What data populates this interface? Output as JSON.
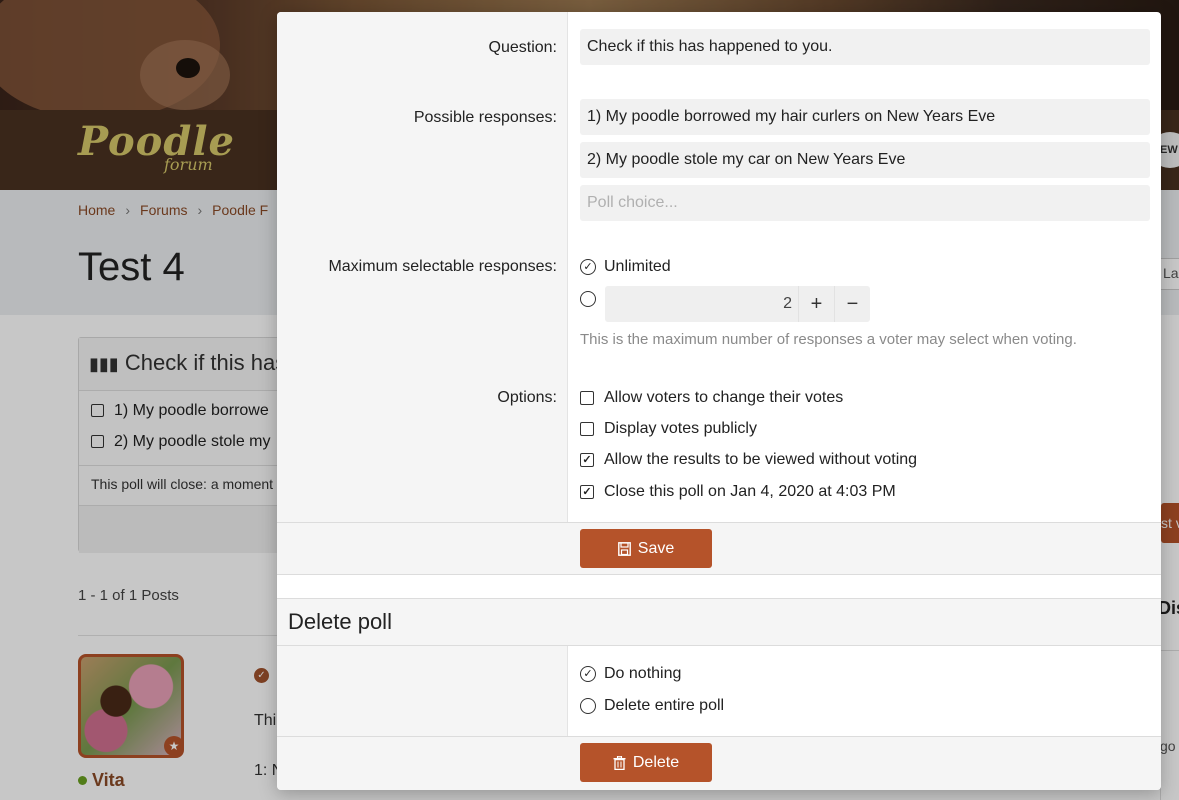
{
  "background": {
    "logo": {
      "main": "Poodle",
      "sub": "forum"
    },
    "new_badge": "EW",
    "breadcrumb": [
      "Home",
      "Forums",
      "Poodle F"
    ],
    "thread_title": "Test 4",
    "right_input_text": "La",
    "poll": {
      "title": "Check if this has",
      "responses": [
        "1) My poodle borrowe",
        "2) My poodle stole my"
      ],
      "close_text": "This poll will close: a moment"
    },
    "posts_count": "1 - 1 of 1 Posts",
    "username": "Vita",
    "post_fragment_1": "Thi",
    "post_fragment_2": "1: N",
    "right_button_text": "st v",
    "right_heading": "Dis",
    "right_ago": "go"
  },
  "modal": {
    "question": {
      "label": "Question:",
      "value": "Check if this has happened to you."
    },
    "responses": {
      "label": "Possible responses:",
      "items": [
        "1) My poodle borrowed my hair curlers on New Years Eve",
        "2) My poodle stole my car on New Years Eve"
      ],
      "placeholder": "Poll choice..."
    },
    "max_responses": {
      "label": "Maximum selectable responses:",
      "unlimited_label": "Unlimited",
      "unlimited_selected": true,
      "count_value": "2",
      "increment": "+",
      "decrement": "−",
      "hint": "This is the maximum number of responses a voter may select when voting."
    },
    "options": {
      "label": "Options:",
      "items": [
        {
          "label": "Allow voters to change their votes",
          "checked": false
        },
        {
          "label": "Display votes publicly",
          "checked": false
        },
        {
          "label": "Allow the results to be viewed without voting",
          "checked": true
        },
        {
          "label": "Close this poll on Jan 4, 2020 at 4:03 PM",
          "checked": true
        }
      ]
    },
    "save_label": "Save",
    "delete_section": {
      "title": "Delete poll",
      "choices": [
        {
          "label": "Do nothing",
          "selected": true
        },
        {
          "label": "Delete entire poll",
          "selected": false
        }
      ],
      "delete_label": "Delete"
    }
  },
  "colors": {
    "accent": "#b5532a",
    "link": "#8a4a26",
    "online": "#6aa020"
  }
}
